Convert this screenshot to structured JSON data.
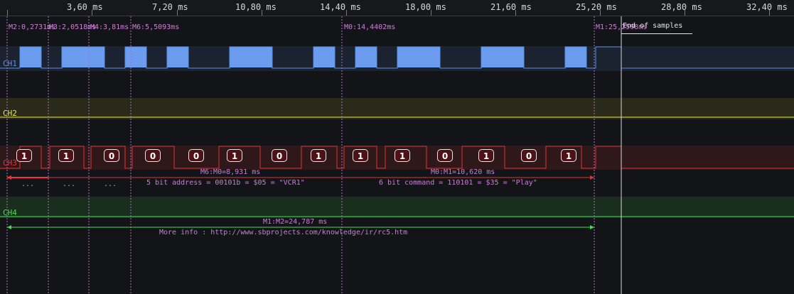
{
  "ruler": {
    "ticks": [
      "3,60 ms",
      "7,20 ms",
      "10,80 ms",
      "14,40 ms",
      "18,00 ms",
      "21,60 ms",
      "25,20 ms",
      "28,80 ms",
      "32,40 ms"
    ]
  },
  "markers": {
    "m2": "M2:0,2731ms",
    "m3": "M3:2,0518ms",
    "m4": "M4:3,81ms",
    "m6": "M6:5,5093ms",
    "m0": "M0:14,4402ms",
    "m1": "M1:25,2598ms"
  },
  "end_of_samples": "End of samples",
  "channels": [
    {
      "label": "CH1",
      "color": "#5a8fe6"
    },
    {
      "label": "CH2",
      "color": "#e8e63a"
    },
    {
      "label": "CH3",
      "color": "#e03434"
    },
    {
      "label": "CH4",
      "color": "#3ee04a"
    }
  ],
  "bits": [
    "1",
    "1",
    "0",
    "0",
    "0",
    "1",
    "0",
    "1",
    "1",
    "1",
    "0",
    "1",
    "0",
    "1"
  ],
  "measurements": {
    "m6_m0": "M6:M0=8,931 ms",
    "m0_m1": "M0:M1=10,620 ms",
    "m1_m2": "M1:M2=24,787 ms",
    "dots_1": "...",
    "dots_2": "...",
    "dots_3": "...",
    "address": "5 bit address = 00101b = $05 = \"VCR1\"",
    "command": "6 bit command = 110101 = $35 = \"Play\"",
    "info": "More info : http://www.sbprojects.com/knowledge/ir/rc5.htm"
  }
}
